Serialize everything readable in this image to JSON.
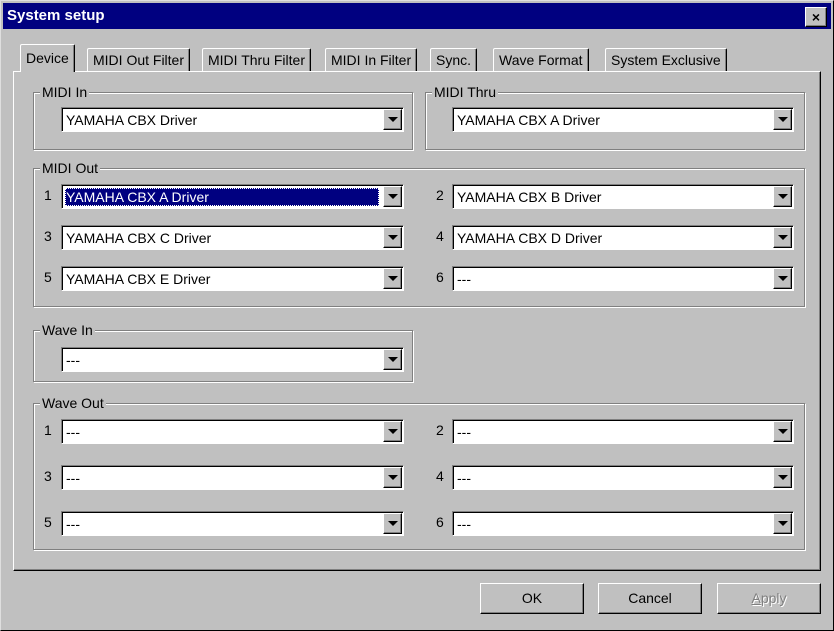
{
  "window": {
    "title": "System setup",
    "close_glyph": "×"
  },
  "tabs": [
    {
      "label": "Device",
      "active": true
    },
    {
      "label": "MIDI Out Filter"
    },
    {
      "label": "MIDI Thru Filter"
    },
    {
      "label": "MIDI In Filter"
    },
    {
      "label": "Sync."
    },
    {
      "label": "Wave Format"
    },
    {
      "label": "System Exclusive"
    }
  ],
  "midi_in": {
    "label": "MIDI In",
    "value": "YAMAHA CBX Driver"
  },
  "midi_thru": {
    "label": "MIDI Thru",
    "value": "YAMAHA CBX A Driver"
  },
  "midi_out": {
    "label": "MIDI Out",
    "ports": [
      {
        "num": "1",
        "value": "YAMAHA CBX A Driver"
      },
      {
        "num": "2",
        "value": "YAMAHA CBX B Driver"
      },
      {
        "num": "3",
        "value": "YAMAHA CBX C Driver"
      },
      {
        "num": "4",
        "value": "YAMAHA CBX D Driver"
      },
      {
        "num": "5",
        "value": "YAMAHA CBX E Driver"
      },
      {
        "num": "6",
        "value": "---"
      }
    ]
  },
  "wave_in": {
    "label": "Wave In",
    "value": "---"
  },
  "wave_out": {
    "label": "Wave Out",
    "ports": [
      {
        "num": "1",
        "value": "---"
      },
      {
        "num": "2",
        "value": "---"
      },
      {
        "num": "3",
        "value": "---"
      },
      {
        "num": "4",
        "value": "---"
      },
      {
        "num": "5",
        "value": "---"
      },
      {
        "num": "6",
        "value": "---"
      }
    ]
  },
  "buttons": {
    "ok": "OK",
    "cancel": "Cancel",
    "apply_first": "A",
    "apply_rest": "pply"
  }
}
